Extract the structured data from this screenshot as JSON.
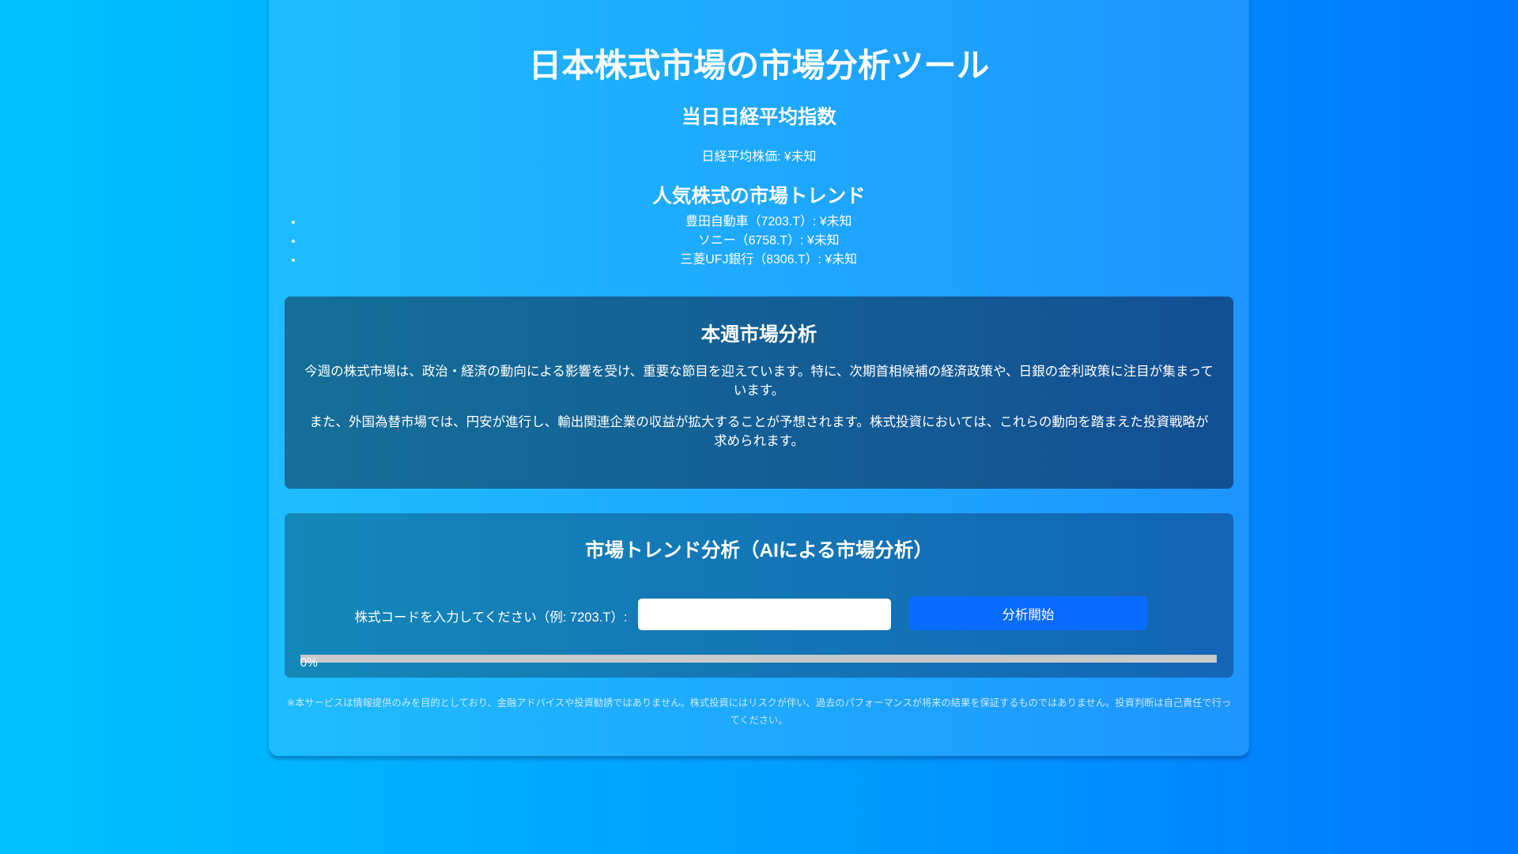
{
  "title": "日本株式市場の市場分析ツール",
  "nikkei": {
    "heading": "当日日経平均指数",
    "text": "日経平均株価: ¥未知"
  },
  "trends": {
    "heading": "人気株式の市場トレンド",
    "items": [
      "豊田自動車（7203.T）: ¥未知",
      "ソニー（6758.T）: ¥未知",
      "三菱UFJ銀行（8306.T）: ¥未知"
    ]
  },
  "weekly": {
    "heading": "本週市場分析",
    "paragraphs": [
      "今週の株式市場は、政治・経済の動向による影響を受け、重要な節目を迎えています。特に、次期首相候補の経済政策や、日銀の金利政策に注目が集まっています。",
      "また、外国為替市場では、円安が進行し、輸出関連企業の収益が拡大することが予想されます。株式投資においては、これらの動向を踏まえた投資戦略が求められます。"
    ]
  },
  "ai": {
    "heading": "市場トレンド分析（AIによる市場分析）",
    "label": "株式コードを入力してください（例: 7203.T）:",
    "input_value": "",
    "button": "分析開始",
    "progress": 0,
    "progress_text": "0%"
  },
  "disclaimer": "※本サービスは情報提供のみを目的としており、金融アドバイスや投資勧誘ではありません。株式投資にはリスクが伴い、過去のパフォーマンスが将来の結果を保証するものではありません。投資判断は自己責任で行ってください。"
}
